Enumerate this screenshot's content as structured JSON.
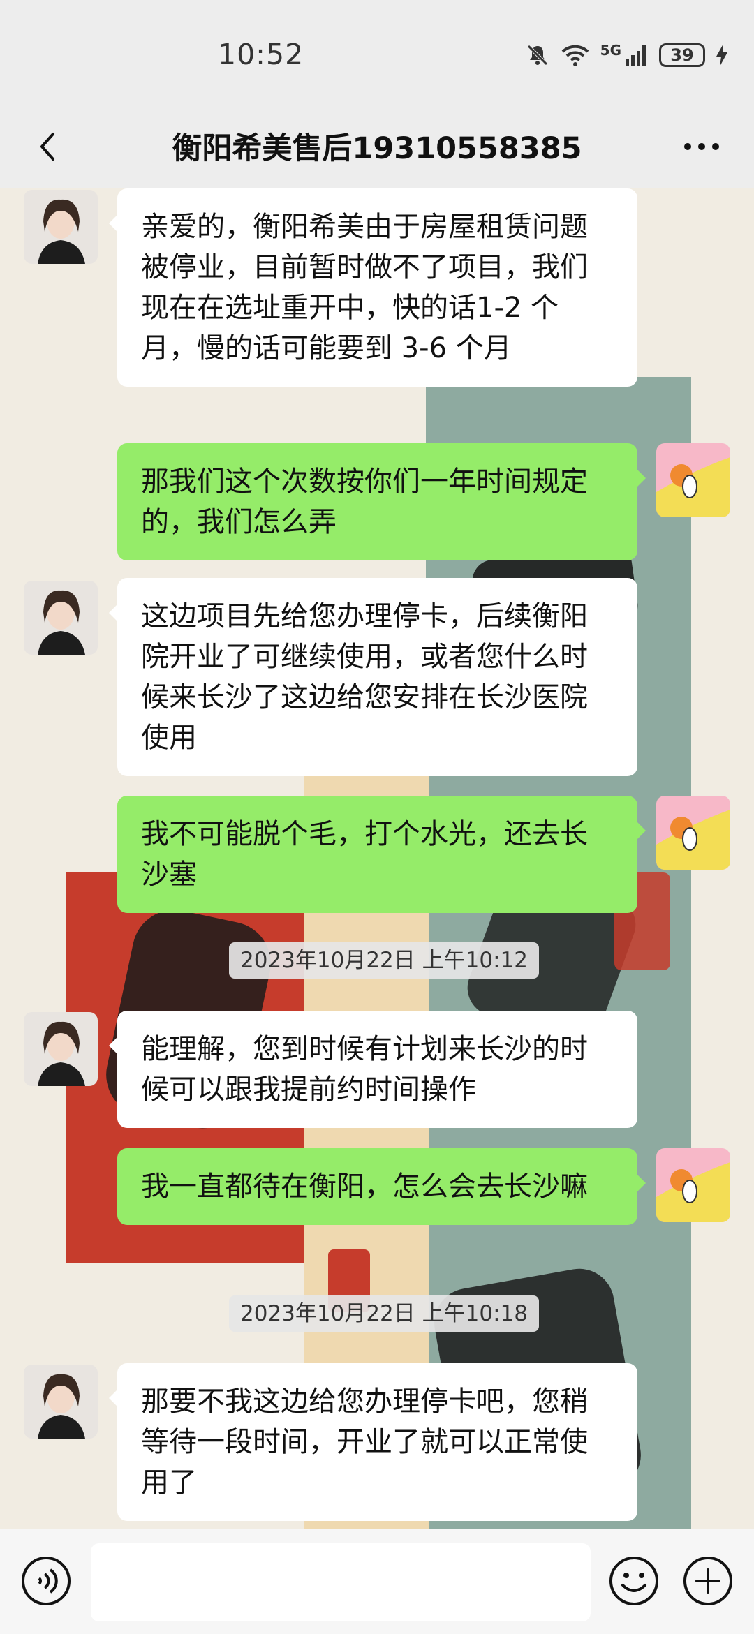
{
  "status_bar": {
    "time": "10:52",
    "network": "5G",
    "battery": "39",
    "icons": [
      "mute-bell-icon",
      "wifi-icon",
      "cell-signal-icon",
      "battery-icon",
      "charging-bolt-icon"
    ]
  },
  "header": {
    "title": "衡阳希美售后19310558385",
    "back_icon": "chevron-left-icon",
    "more_icon": "more-dots-icon"
  },
  "messages": [
    {
      "side": "in",
      "text": "亲爱的，衡阳希美由于房屋租赁问题被停业，目前暂时做不了项目，我们现在在选址重开中，快的话1-2 个月，慢的话可能要到 3-6 个月"
    },
    {
      "side": "out",
      "text": "那我们这个次数按你们一年时间规定的，我们怎么弄"
    },
    {
      "side": "in",
      "text": "这边项目先给您办理停卡，后续衡阳院开业了可继续使用，或者您什么时候来长沙了这边给您安排在长沙医院使用"
    },
    {
      "side": "out",
      "text": "我不可能脱个毛，打个水光，还去长沙塞"
    },
    {
      "type": "time",
      "text": "2023年10月22日 上午10:12"
    },
    {
      "side": "in",
      "text": "能理解，您到时候有计划来长沙的时候可以跟我提前约时间操作"
    },
    {
      "side": "out",
      "text": "我一直都待在衡阳，怎么会去长沙嘛"
    },
    {
      "type": "time",
      "text": "2023年10月22日 上午10:18"
    },
    {
      "side": "in",
      "text": "那要不我这边给您办理停卡吧，您稍等待一段时间，开业了就可以正常使用了"
    }
  ],
  "input_bar": {
    "voice_icon": "voice-icon",
    "input_value": "",
    "emoji_icon": "emoji-icon",
    "plus_icon": "plus-icon"
  }
}
